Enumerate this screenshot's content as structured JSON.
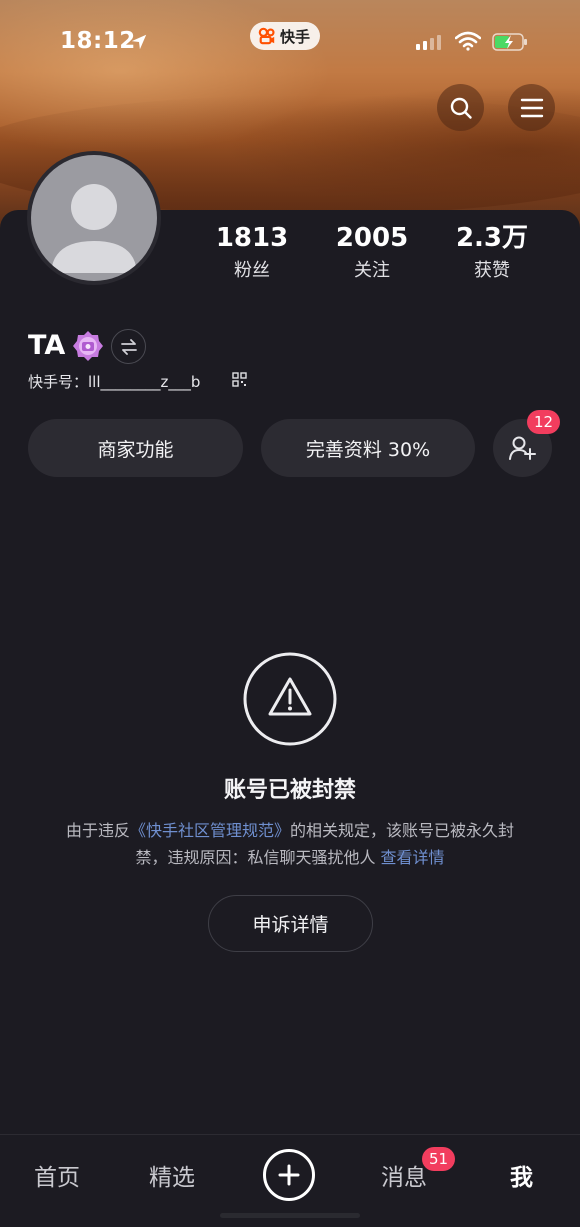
{
  "status_bar": {
    "time": "18:12",
    "app_badge": "快手"
  },
  "profile": {
    "stats": [
      {
        "value": "1813",
        "label": "粉丝"
      },
      {
        "value": "2005",
        "label": "关注"
      },
      {
        "value": "2.3万",
        "label": "获赞"
      }
    ],
    "name": "TA",
    "kuaishou_id": "快手号：lll________z___b"
  },
  "actions": {
    "merchant": "商家功能",
    "complete_profile": "完善资料 30%",
    "add_friend_badge": "12"
  },
  "ban_notice": {
    "title": "账号已被封禁",
    "desc_prefix": "由于违反",
    "desc_link": "《快手社区管理规范》",
    "desc_mid": "的相关规定，该账号已被永久封禁，违规原因：私信聊天骚扰他人 ",
    "desc_detail_link": "查看详情",
    "appeal_button": "申诉详情"
  },
  "tabbar": {
    "home": "首页",
    "featured": "精选",
    "messages": "消息",
    "messages_badge": "51",
    "me": "我"
  },
  "colors": {
    "background": "#1c1b22",
    "badge_red": "#f23d5e",
    "link_blue": "#6f8fcf"
  },
  "icons": [
    "location-arrow-icon",
    "kuaishou-logo-icon",
    "signal-icon",
    "wifi-icon",
    "battery-charging-icon",
    "search-icon",
    "menu-icon",
    "avatar-placeholder-icon",
    "level-badge-icon",
    "switch-account-icon",
    "qr-code-icon",
    "add-friend-icon",
    "warning-icon",
    "plus-icon"
  ]
}
